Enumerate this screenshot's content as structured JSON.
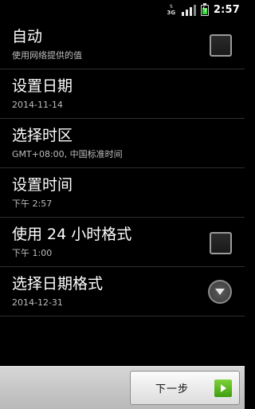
{
  "status_bar": {
    "network_arrows": "⇅",
    "network_type": "3G",
    "signal_bars": 3,
    "signal_max": 4,
    "battery_icon": "battery-charging-icon",
    "time": "2:57"
  },
  "settings": [
    {
      "title": "自动",
      "summary": "使用网络提供的值",
      "control": "checkbox",
      "checked": false
    },
    {
      "title": "设置日期",
      "summary": "2014-11-14"
    },
    {
      "title": "选择时区",
      "summary": "GMT+08:00, 中国标准时间"
    },
    {
      "title": "设置时间",
      "summary": "下午 2:57"
    },
    {
      "title": "使用 24 小时格式",
      "summary": "下午 1:00",
      "control": "checkbox",
      "checked": false
    },
    {
      "title": "选择日期格式",
      "summary": "2014-12-31",
      "control": "dropdown"
    }
  ],
  "bottom_bar": {
    "next_label": "下一步",
    "next_icon": "arrow-right-icon"
  },
  "colors": {
    "background": "#000000",
    "summary_text": "#bdbdbd",
    "accent_green": "#5bb81f"
  }
}
